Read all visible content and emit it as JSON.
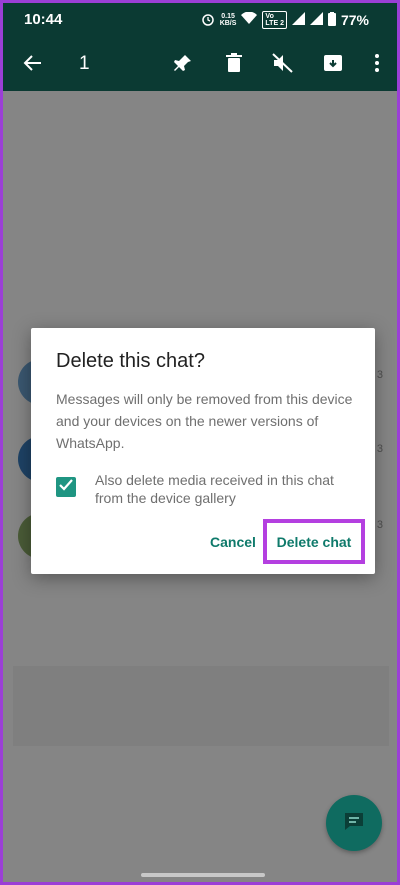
{
  "status_bar": {
    "time": "10:44",
    "net_speed_value": "0.15",
    "net_speed_unit": "KB/S",
    "volte_top": "Vo",
    "volte_bottom": "LTE 2",
    "battery": "77%"
  },
  "action_bar": {
    "selected_count": "1",
    "icons": [
      "back-arrow-icon",
      "pin-icon",
      "delete-icon",
      "mute-icon",
      "archive-icon",
      "more-options-icon"
    ]
  },
  "dialog": {
    "title": "Delete this chat?",
    "message": "Messages will only be removed from this device and your devices on the newer versions of WhatsApp.",
    "checkbox_label": "Also delete media received in this chat from the device gallery",
    "checkbox_checked": true,
    "cancel_label": "Cancel",
    "delete_label": "Delete chat"
  },
  "list_partial": [
    "3",
    "3",
    "3"
  ],
  "colors": {
    "header": "#0b3a33",
    "accent": "#0f7a6b",
    "checkbox": "#1f9582",
    "highlight": "#b43fe0"
  },
  "fab_icon": "new-chat-icon"
}
